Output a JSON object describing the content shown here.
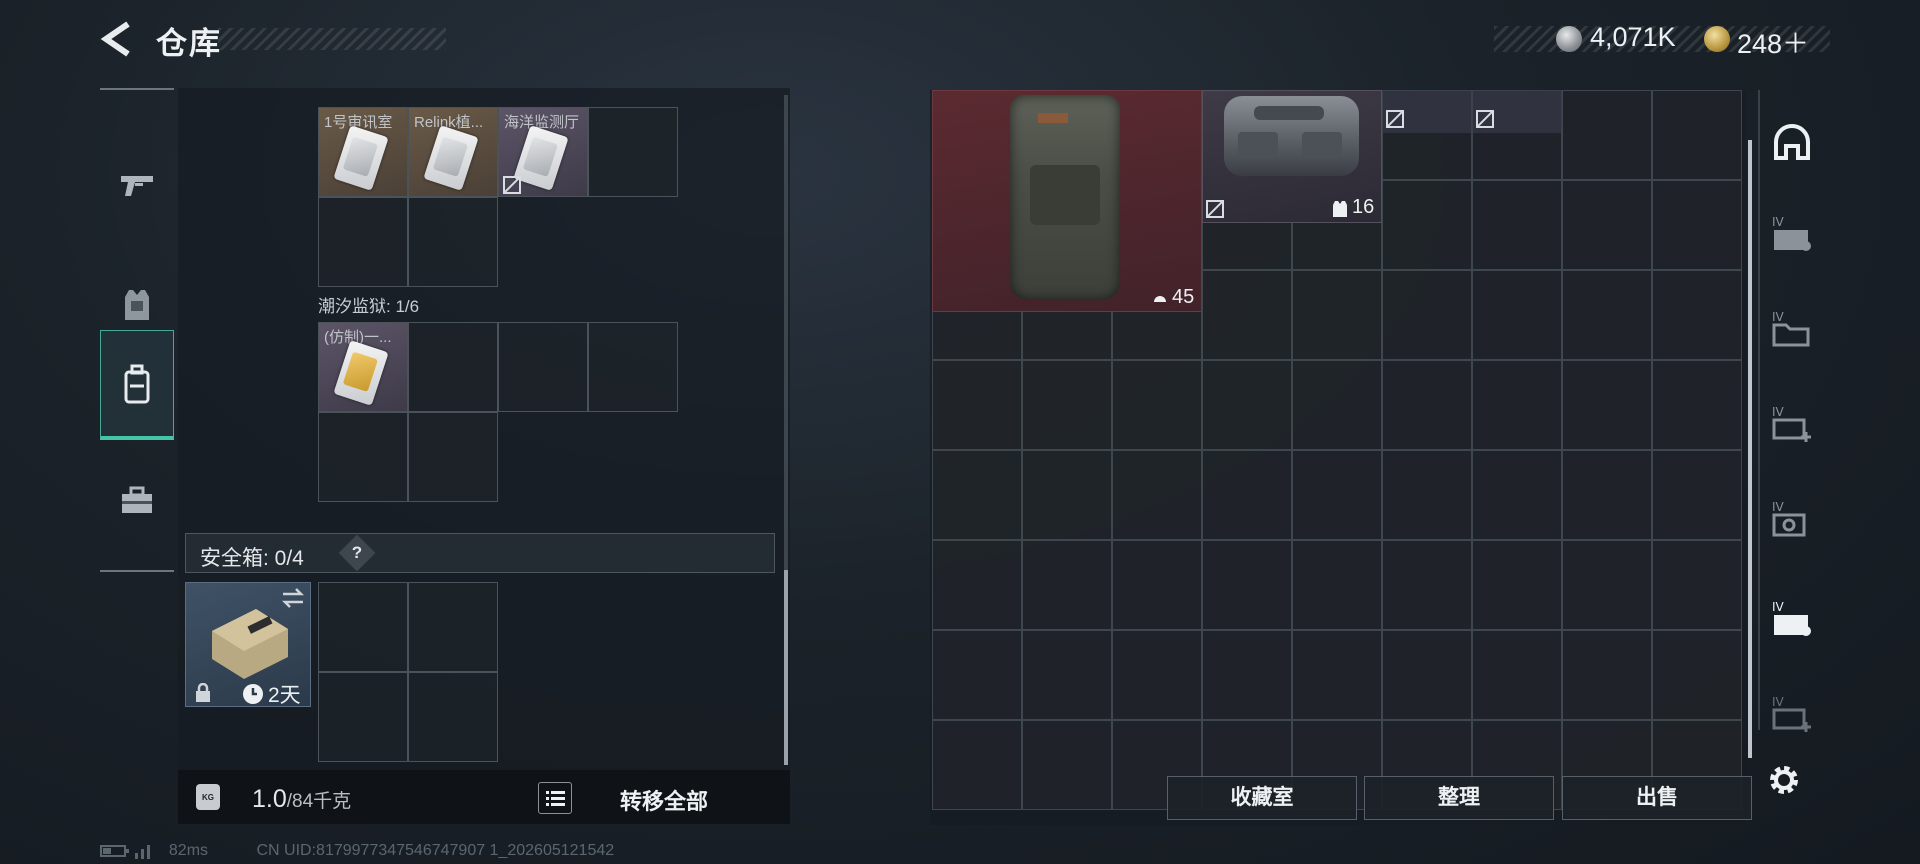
{
  "header": {
    "title": "仓库",
    "currency_silver": "4,071K",
    "currency_gold": "248＋"
  },
  "left_nav": {
    "items": [
      {
        "icon": "pistol-icon"
      },
      {
        "icon": "armor-vest-icon"
      },
      {
        "icon": "backpack-icon",
        "active": true
      },
      {
        "icon": "toolbox-icon"
      }
    ]
  },
  "containers": {
    "top": {
      "items": [
        "1号审讯室",
        "Relink植...",
        "海洋监测厅"
      ]
    },
    "tide_prison": {
      "label": "潮汐监狱: 1/6",
      "items": [
        "(仿制)一..."
      ]
    },
    "safe_box": {
      "label": "安全箱: 0/4",
      "help": "?",
      "duration": "2天"
    }
  },
  "weight_bar": {
    "current": "1.0",
    "max": "/84千克",
    "transfer_label": "转移全部"
  },
  "stash": {
    "backpack_count": "45",
    "bag_count": "16"
  },
  "right_nav": {
    "icons": [
      "helmet-icon",
      "chest-rig-icon",
      "folder-icon",
      "medkit-icon",
      "camera-icon",
      "equipment-case-icon",
      "health-pack-icon",
      "gear-icon"
    ]
  },
  "buttons": {
    "collection": "收藏室",
    "sort": "整理",
    "sell": "出售"
  },
  "status": {
    "ping": "82ms",
    "uid": "CN UID:8179977347546747907 1_202605121542"
  },
  "colors": {
    "accent": "#45c4a7",
    "backpack_bg": "#5b2a30",
    "bag_bg": "#3e3a46"
  }
}
